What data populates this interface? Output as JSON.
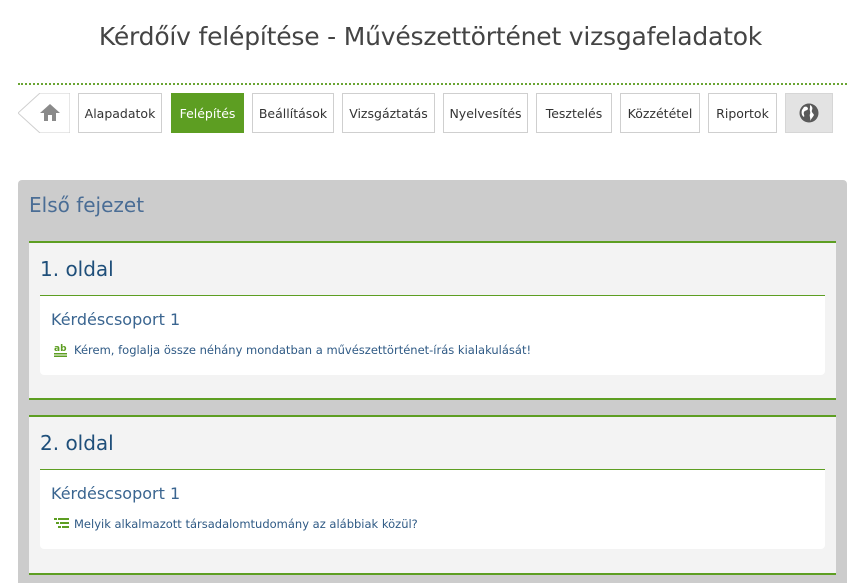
{
  "header": {
    "title": "Kérdőív felépítése - Művészettörténet vizsgafeladatok"
  },
  "nav": {
    "tabs": [
      {
        "label": "Alapadatok",
        "active": false
      },
      {
        "label": "Felépítés",
        "active": true
      },
      {
        "label": "Beállítások",
        "active": false
      },
      {
        "label": "Vizsgáztatás",
        "active": false
      },
      {
        "label": "Nyelvesítés",
        "active": false
      },
      {
        "label": "Tesztelés",
        "active": false
      },
      {
        "label": "Közzététel",
        "active": false
      },
      {
        "label": "Riportok",
        "active": false
      }
    ],
    "home_icon": "home-icon",
    "language_icon": "globe-icon"
  },
  "chapter": {
    "title": "Első fejezet",
    "pages": [
      {
        "title": "1. oldal",
        "group": {
          "title": "Kérdéscsoport 1",
          "question": {
            "icon": "text-answer-icon",
            "icon_text": "ab",
            "text": "Kérem, foglalja össze néhány mondatban a művészettörténet-írás kialakulását!"
          }
        }
      },
      {
        "title": "2. oldal",
        "group": {
          "title": "Kérdéscsoport 1",
          "question": {
            "icon": "list-choice-icon",
            "text": "Melyik alkalmazott társadalomtudomány az alábbiak közül?"
          }
        }
      }
    ]
  },
  "colors": {
    "accent": "#5d9e22",
    "title_blue": "#1f4f7a",
    "chapter_blue": "#4a6d95",
    "panel_gray": "#cccccc"
  }
}
